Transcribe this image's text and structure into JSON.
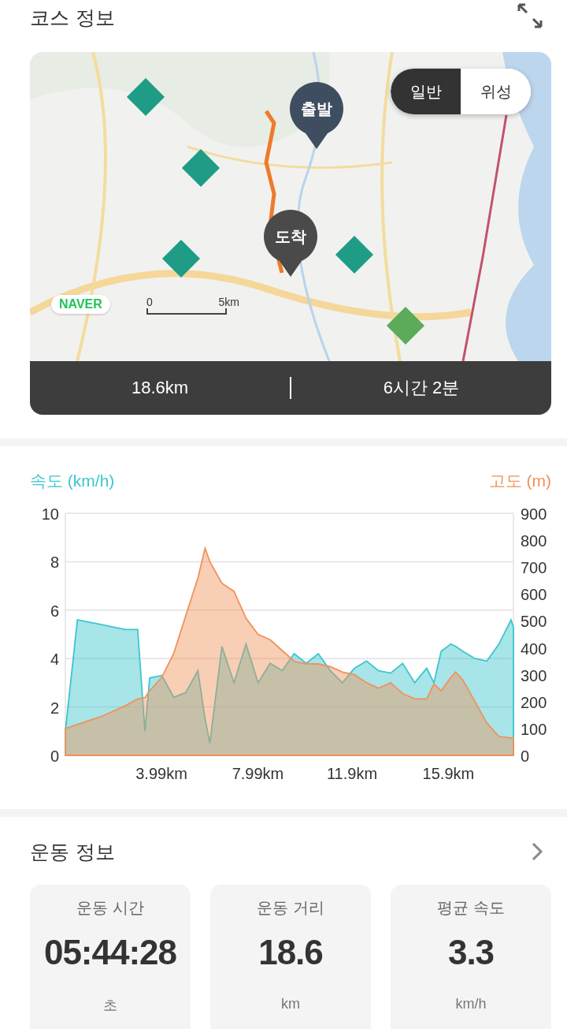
{
  "course": {
    "title": "코스 정보",
    "map": {
      "view_toggle": [
        {
          "label": "일반",
          "selected": true
        },
        {
          "label": "위성",
          "selected": false
        }
      ],
      "pins": [
        {
          "label": "출발",
          "kind": "start"
        },
        {
          "label": "도착",
          "kind": "end"
        }
      ],
      "logo": "NAVER",
      "scale": {
        "start": "0",
        "end": "5km"
      }
    },
    "summary": {
      "distance": "18.6km",
      "duration": "6시간 2분"
    }
  },
  "chart": {
    "chart_data": {
      "type": "area",
      "ylabel": "속도 (km/h)",
      "y2label": "고도 (m)",
      "grid": true,
      "x": [
        0,
        0.5,
        1,
        1.5,
        2,
        2.5,
        3,
        3.3,
        3.5,
        4,
        4.5,
        5,
        5.5,
        5.8,
        6,
        6.5,
        7,
        7.5,
        8,
        8.5,
        9,
        9.5,
        10,
        10.5,
        11,
        11.5,
        12,
        12.5,
        13,
        13.5,
        14,
        14.5,
        15,
        15.3,
        15.6,
        16,
        16.2,
        16.5,
        17,
        17.5,
        18,
        18.5,
        18.6
      ],
      "xlim": [
        0,
        18.6
      ],
      "xticks": [
        {
          "value": 3.99,
          "label": "3.99km"
        },
        {
          "value": 7.99,
          "label": "7.99km"
        },
        {
          "value": 11.9,
          "label": "11.9km"
        },
        {
          "value": 15.9,
          "label": "15.9km"
        }
      ],
      "ylim": [
        0,
        10
      ],
      "yticks": [
        0,
        2,
        4,
        6,
        8,
        10
      ],
      "y2lim": [
        0,
        900
      ],
      "y2ticks": [
        0,
        100,
        200,
        300,
        400,
        500,
        600,
        700,
        800,
        900
      ],
      "series": [
        {
          "color": "#3cc6cf",
          "values": [
            1,
            5.6,
            5.5,
            5.4,
            5.3,
            5.2,
            5.2,
            1,
            3.2,
            3.3,
            2.4,
            2.6,
            3.5,
            1.5,
            0.5,
            4.5,
            3,
            4.6,
            3,
            3.8,
            3.5,
            4.2,
            3.8,
            4.2,
            3.5,
            3,
            3.6,
            3.9,
            3.5,
            3.4,
            3.8,
            3,
            3.6,
            3,
            4.3,
            4.6,
            4.5,
            4.3,
            4,
            3.9,
            4.6,
            5.6,
            5.3
          ]
        },
        {
          "axis": "y2",
          "color": "#f0925a",
          "values": [
            100,
            115,
            130,
            145,
            165,
            185,
            210,
            215,
            240,
            290,
            380,
            520,
            660,
            770,
            720,
            640,
            610,
            510,
            450,
            430,
            390,
            350,
            340,
            340,
            330,
            310,
            300,
            270,
            250,
            270,
            230,
            210,
            210,
            265,
            240,
            290,
            310,
            280,
            200,
            120,
            70,
            65,
            65
          ]
        }
      ]
    }
  },
  "workout": {
    "title": "운동 정보",
    "stats": [
      {
        "label": "운동 시간",
        "value": "05:44:28",
        "unit": "초"
      },
      {
        "label": "운동 거리",
        "value": "18.6",
        "unit": "km"
      },
      {
        "label": "평균 속도",
        "value": "3.3",
        "unit": "km/h"
      }
    ]
  }
}
